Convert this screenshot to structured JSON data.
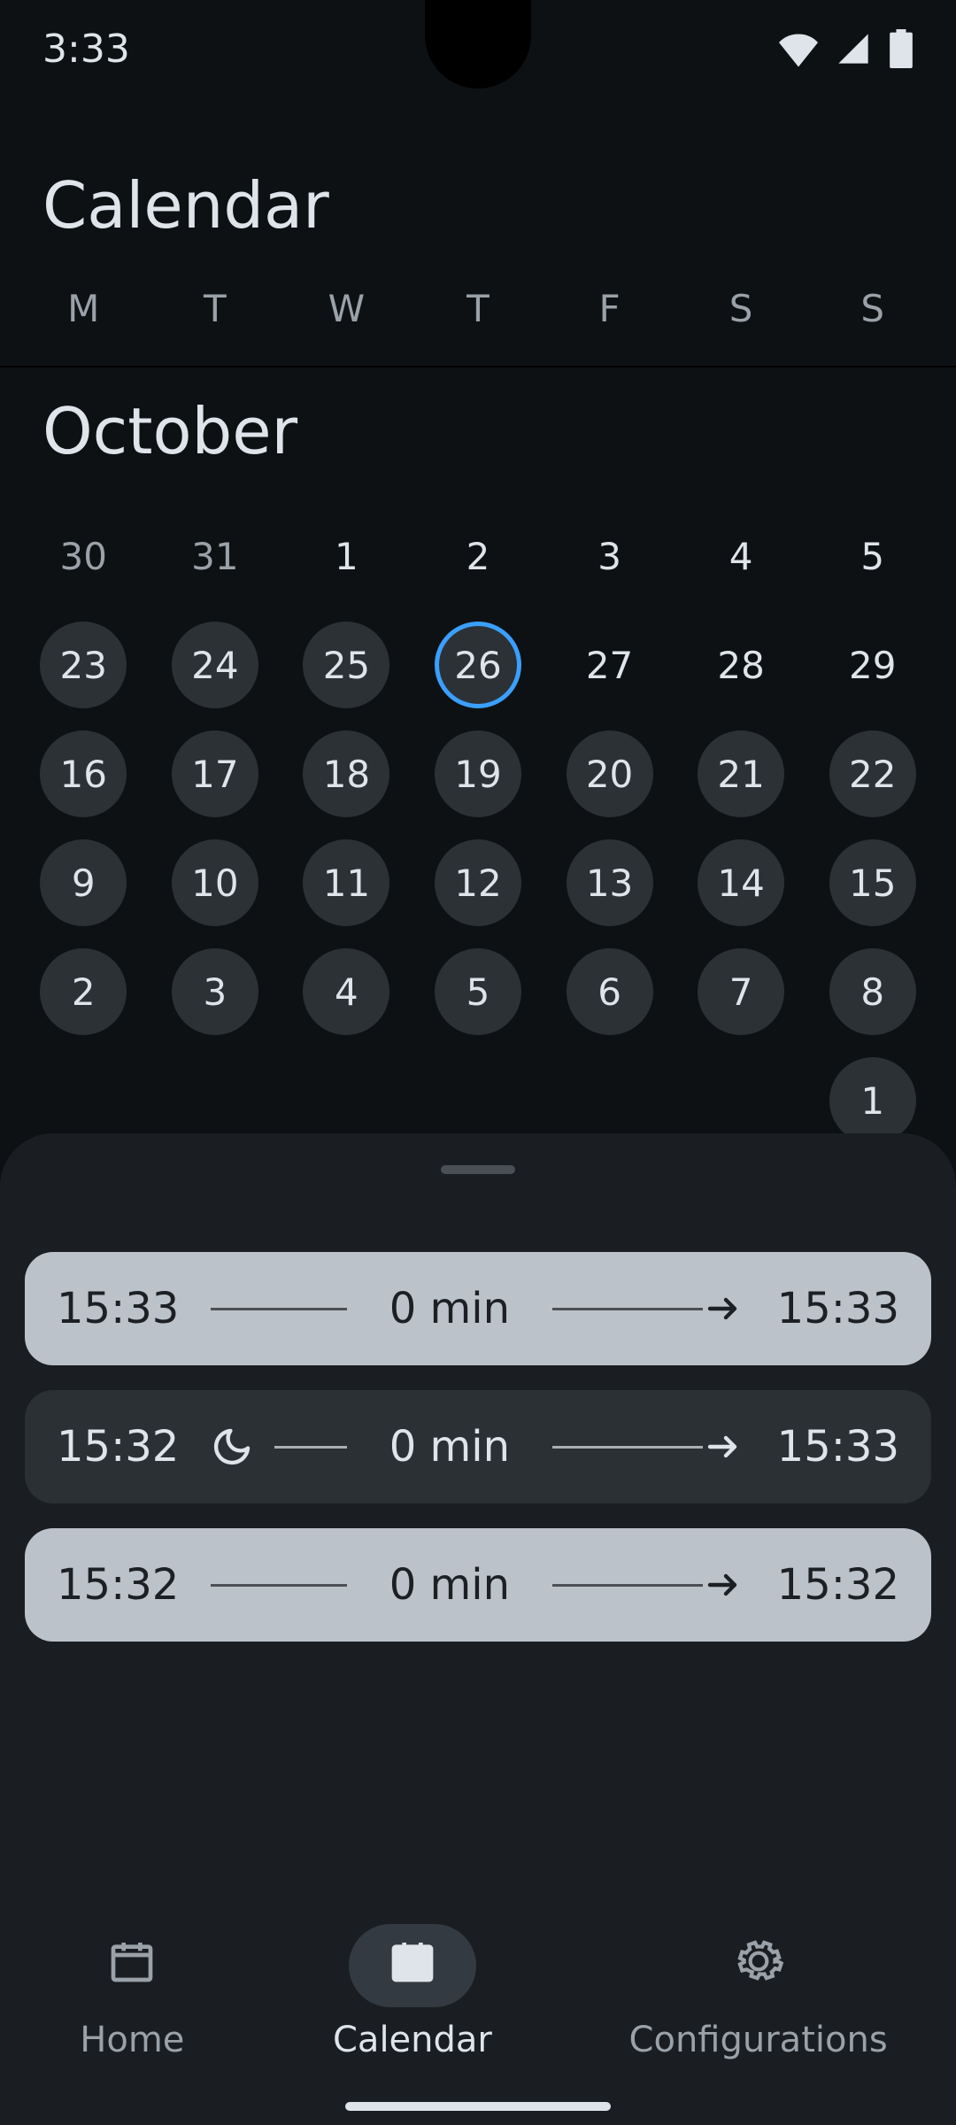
{
  "status": {
    "time": "3:33"
  },
  "header": {
    "title": "Calendar"
  },
  "weekdays": [
    "M",
    "T",
    "W",
    "T",
    "F",
    "S",
    "S"
  ],
  "month": {
    "label": "October"
  },
  "calendar": {
    "selected_day": 26,
    "rows": [
      {
        "days": [
          {
            "n": "30",
            "style": "plain dim"
          },
          {
            "n": "31",
            "style": "plain dim"
          },
          {
            "n": "1",
            "style": "plain"
          },
          {
            "n": "2",
            "style": "plain"
          },
          {
            "n": "3",
            "style": "plain"
          },
          {
            "n": "4",
            "style": "plain"
          },
          {
            "n": "5",
            "style": "plain"
          }
        ]
      },
      {
        "days": [
          {
            "n": "23",
            "style": "chip"
          },
          {
            "n": "24",
            "style": "chip"
          },
          {
            "n": "25",
            "style": "chip"
          },
          {
            "n": "26",
            "style": "selected"
          },
          {
            "n": "27",
            "style": "plain"
          },
          {
            "n": "28",
            "style": "plain"
          },
          {
            "n": "29",
            "style": "plain"
          }
        ]
      },
      {
        "days": [
          {
            "n": "16",
            "style": "chip"
          },
          {
            "n": "17",
            "style": "chip"
          },
          {
            "n": "18",
            "style": "chip"
          },
          {
            "n": "19",
            "style": "chip"
          },
          {
            "n": "20",
            "style": "chip"
          },
          {
            "n": "21",
            "style": "chip"
          },
          {
            "n": "22",
            "style": "chip"
          }
        ]
      },
      {
        "days": [
          {
            "n": "9",
            "style": "chip"
          },
          {
            "n": "10",
            "style": "chip"
          },
          {
            "n": "11",
            "style": "chip"
          },
          {
            "n": "12",
            "style": "chip"
          },
          {
            "n": "13",
            "style": "chip"
          },
          {
            "n": "14",
            "style": "chip"
          },
          {
            "n": "15",
            "style": "chip"
          }
        ]
      },
      {
        "days": [
          {
            "n": "2",
            "style": "chip"
          },
          {
            "n": "3",
            "style": "chip"
          },
          {
            "n": "4",
            "style": "chip"
          },
          {
            "n": "5",
            "style": "chip"
          },
          {
            "n": "6",
            "style": "chip"
          },
          {
            "n": "7",
            "style": "chip"
          },
          {
            "n": "8",
            "style": "chip"
          }
        ]
      },
      {
        "days": [
          {
            "n": "",
            "style": "plain"
          },
          {
            "n": "",
            "style": "plain"
          },
          {
            "n": "",
            "style": "plain"
          },
          {
            "n": "",
            "style": "plain"
          },
          {
            "n": "",
            "style": "plain"
          },
          {
            "n": "",
            "style": "plain"
          },
          {
            "n": "1",
            "style": "chip"
          }
        ]
      }
    ]
  },
  "entries": [
    {
      "start": "15:33",
      "duration": "0 min",
      "end": "15:33",
      "variant": "light",
      "icon": null
    },
    {
      "start": "15:32",
      "duration": "0 min",
      "end": "15:33",
      "variant": "dark",
      "icon": "moon"
    },
    {
      "start": "15:32",
      "duration": "0 min",
      "end": "15:32",
      "variant": "light",
      "icon": null
    }
  ],
  "nav": {
    "items": [
      {
        "label": "Home",
        "icon": "calendar-outline",
        "active": false
      },
      {
        "label": "Calendar",
        "icon": "calendar-filled",
        "active": true
      },
      {
        "label": "Configurations",
        "icon": "gear",
        "active": false
      }
    ]
  }
}
